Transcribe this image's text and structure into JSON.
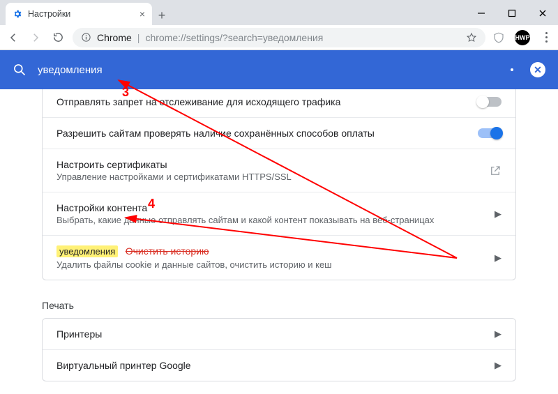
{
  "window": {
    "tab_title": "Настройки",
    "min": "—",
    "max": "□",
    "close": "✕"
  },
  "omnibox": {
    "prefix": "Chrome",
    "url": "chrome://settings/?search=уведомления"
  },
  "search": {
    "value": "уведомления"
  },
  "rows": {
    "dnt": {
      "title": "Отправлять запрет на отслеживание для исходящего трафика"
    },
    "pay": {
      "title": "Разрешить сайтам проверять наличие сохранённых способов оплаты"
    },
    "cert": {
      "title": "Настроить сертификаты",
      "sub": "Управление настройками и сертификатами HTTPS/SSL"
    },
    "content": {
      "title": "Настройки контента",
      "sub": "Выбрать, какие данные отправлять сайтам и какой контент показывать на веб-страницах"
    },
    "clear": {
      "highlight": "уведомления",
      "strike": "Очистить историю",
      "sub": "Удалить файлы cookie и данные сайтов, очистить историю и кеш"
    }
  },
  "print": {
    "section": "Печать",
    "printers": "Принтеры",
    "virtual": "Виртуальный принтер Google"
  },
  "ann": {
    "three": "3",
    "four": "4"
  },
  "avatar": "HWP"
}
